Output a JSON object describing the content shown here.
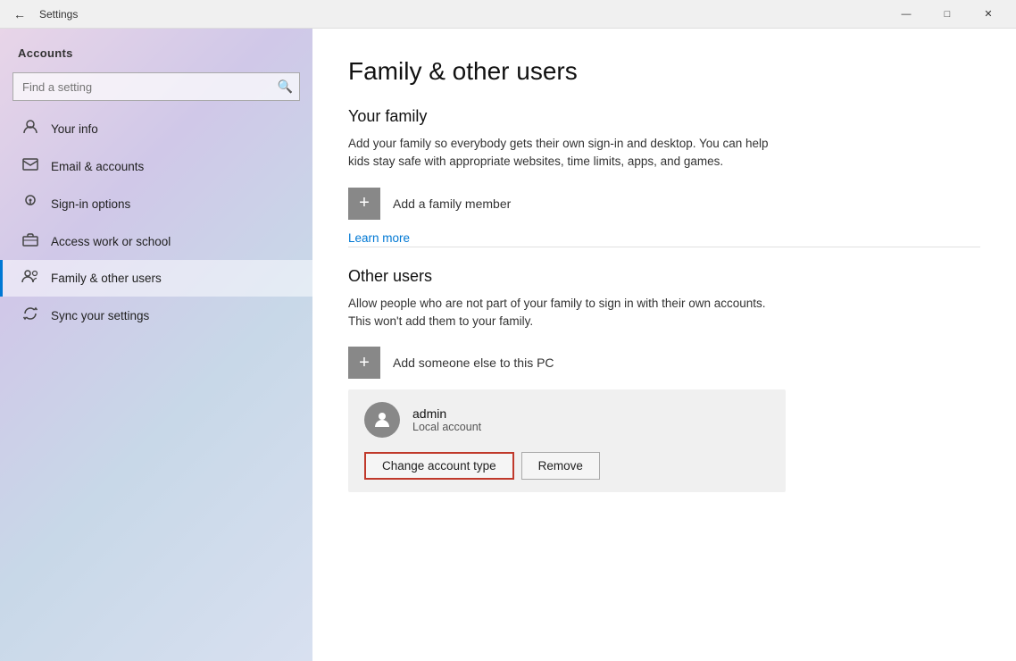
{
  "titlebar": {
    "title": "Settings",
    "back_label": "←",
    "minimize_label": "—",
    "maximize_label": "□",
    "close_label": "✕"
  },
  "sidebar": {
    "section_title": "Accounts",
    "search_placeholder": "Find a setting",
    "nav_items": [
      {
        "id": "your-info",
        "label": "Your info",
        "icon": "👤"
      },
      {
        "id": "email-accounts",
        "label": "Email & accounts",
        "icon": "✉"
      },
      {
        "id": "sign-in",
        "label": "Sign-in options",
        "icon": "🔑"
      },
      {
        "id": "access-work",
        "label": "Access work or school",
        "icon": "💼"
      },
      {
        "id": "family-users",
        "label": "Family & other users",
        "icon": "👥",
        "active": true
      },
      {
        "id": "sync-settings",
        "label": "Sync your settings",
        "icon": "🔄"
      }
    ]
  },
  "content": {
    "page_title": "Family & other users",
    "family_section": {
      "title": "Your family",
      "description": "Add your family so everybody gets their own sign-in and desktop. You can help kids stay safe with appropriate websites, time limits, apps, and games.",
      "add_label": "Add a family member",
      "learn_more": "Learn more"
    },
    "other_users_section": {
      "title": "Other users",
      "description": "Allow people who are not part of your family to sign in with their own accounts. This won't add them to your family.",
      "add_label": "Add someone else to this PC"
    },
    "user_card": {
      "name": "admin",
      "type": "Local account",
      "change_btn": "Change account type",
      "remove_btn": "Remove"
    }
  }
}
